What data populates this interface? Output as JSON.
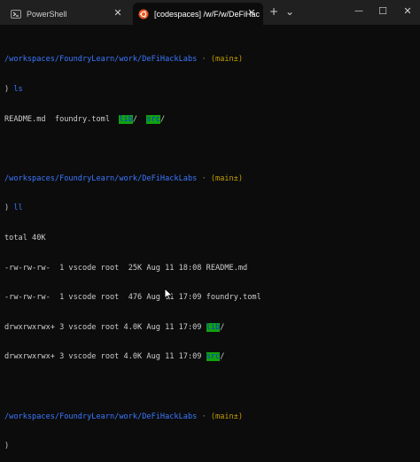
{
  "tabs": [
    {
      "label": "PowerShell",
      "icon": "powershell-icon"
    },
    {
      "label": "[codespaces] /w/F/w/DeFiHac",
      "icon": "ubuntu-icon"
    }
  ],
  "window_controls": {
    "new_tab": "+",
    "dropdown": "⌄",
    "minimize": "—",
    "maximize": "☐",
    "close": "✕"
  },
  "terminal": {
    "block1": {
      "path": "/workspaces/FoundryLearn/work/DeFiHackLabs",
      "sep": " · ",
      "git_open": "(",
      "branch": "main",
      "git_close": "±)",
      "prompt": ")",
      "cmd": "ls",
      "out_files": "README.md  foundry.toml  ",
      "dir1": "lib",
      "slash1": "/  ",
      "dir2": "src",
      "slash2": "/"
    },
    "block2": {
      "path": "/workspaces/FoundryLearn/work/DeFiHackLabs",
      "sep": " · ",
      "git_open": "(",
      "branch": "main",
      "git_close": "±)",
      "prompt": ")",
      "cmd": "ll",
      "total": "total 40K",
      "row1": "-rw-rw-rw-  1 vscode root  25K Aug 11 18:08 README.md",
      "row2": "-rw-rw-rw-  1 vscode root  476 Aug 11 17:09 foundry.toml",
      "row3_prefix": "drwxrwxrwx+ 3 vscode root 4.0K Aug 11 17:09 ",
      "row3_dir": "lib",
      "row3_slash": "/",
      "row4_prefix": "drwxrwxrwx+ 3 vscode root 4.0K Aug 11 17:09 ",
      "row4_dir": "src",
      "row4_slash": "/"
    },
    "block3": {
      "path": "/workspaces/FoundryLearn/work/DeFiHackLabs",
      "sep": " · ",
      "git_open": "(",
      "branch": "main",
      "git_close": "±)",
      "prompt": ")"
    }
  }
}
